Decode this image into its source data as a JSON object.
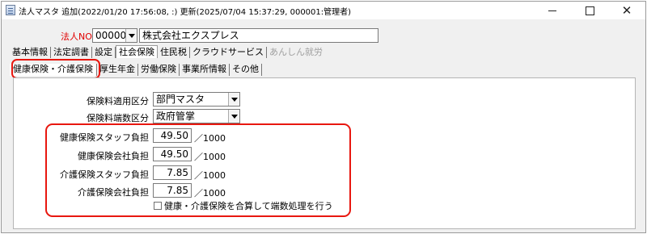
{
  "window": {
    "title": "法人マスタ 追加(2022/01/20 17:56:08, :) 更新(2025/07/04 15:37:29, 000001:管理者)",
    "minimize_label": "",
    "maximize_label": "",
    "close_label": "✕"
  },
  "header": {
    "corp_no_label": "法人NO",
    "corp_no_value": "000001",
    "corp_name": "株式会社エクスプレス"
  },
  "main_tabs": [
    {
      "label": "基本情報",
      "active": false
    },
    {
      "label": "法定調書",
      "active": false
    },
    {
      "label": "設定",
      "active": false
    },
    {
      "label": "社会保険",
      "active": true
    },
    {
      "label": "住民税",
      "active": false
    },
    {
      "label": "クラウドサービス",
      "active": false
    },
    {
      "label": "あんしん就労",
      "active": false,
      "disabled": true
    }
  ],
  "sub_tabs": [
    {
      "label": "健康保険・介護保険",
      "active": true
    },
    {
      "label": "厚生年金",
      "active": false
    },
    {
      "label": "労働保険",
      "active": false
    },
    {
      "label": "事業所情報",
      "active": false
    },
    {
      "label": "その他",
      "active": false
    }
  ],
  "settings": {
    "rate_category_label": "保険料適用区分",
    "rate_category_value": "部門マスタ",
    "rounding_category_label": "保険料端数区分",
    "rounding_category_value": "政府管掌"
  },
  "burden": {
    "health_staff_label": "健康保険スタッフ負担",
    "health_staff_value": "49.50",
    "health_company_label": "健康保険会社負担",
    "health_company_value": "49.50",
    "care_staff_label": "介護保険スタッフ負担",
    "care_staff_value": "7.85",
    "care_company_label": "介護保険会社負担",
    "care_company_value": "7.85",
    "unit": "／1000",
    "combine_checkbox_label": "健康・介護保険を合算して端数処理を行う",
    "combine_checked": false
  },
  "colors": {
    "highlight": "#e8170f",
    "corp_label": "#e00000"
  }
}
